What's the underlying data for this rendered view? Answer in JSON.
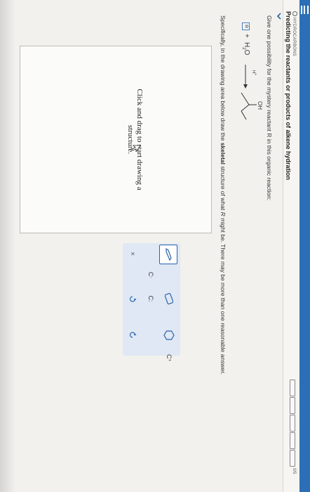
{
  "header": {
    "section": "HYDROCARBONS",
    "title": "Predicting the reactants or products of alkene hydration",
    "progress_segments": 5,
    "progress_completed": 0,
    "progress_count": "0/5"
  },
  "question": {
    "prompt": "Give one possibility for the mystery reactant R in this organic reaction:",
    "reactant_label": "R",
    "plus": "+",
    "water_main": "H",
    "water_sub": "2",
    "water_end": "O",
    "catalyst_main": "H",
    "catalyst_sup": "+",
    "product_group": "OH",
    "instruction_pre": "Specifically, in the drawing area below draw the ",
    "instruction_bold": "skeletal",
    "instruction_mid": " structure of what ",
    "instruction_italic": "R",
    "instruction_post": " might be. There may be more than one reasonable answer."
  },
  "canvas": {
    "hint_line1": "Click and drag to start drawing a",
    "hint_line2": "structure."
  },
  "toolbox": {
    "charge_plus_base": "C",
    "charge_plus_sup": "+",
    "charge_minus_base": "C",
    "charge_minus_sup": "-",
    "lone_pair_label": "C:",
    "clear_label": "×"
  },
  "colors": {
    "topbar": "#2d6fb6",
    "accent": "#2a62aa",
    "toolbox_bg": "#dfe8f4"
  },
  "icons": [
    "menu-icon",
    "chevron-down-icon",
    "arrow-right-icon",
    "pencil-icon",
    "eraser-icon",
    "templates-icon",
    "undo-icon",
    "redo-icon",
    "clear-icon"
  ]
}
